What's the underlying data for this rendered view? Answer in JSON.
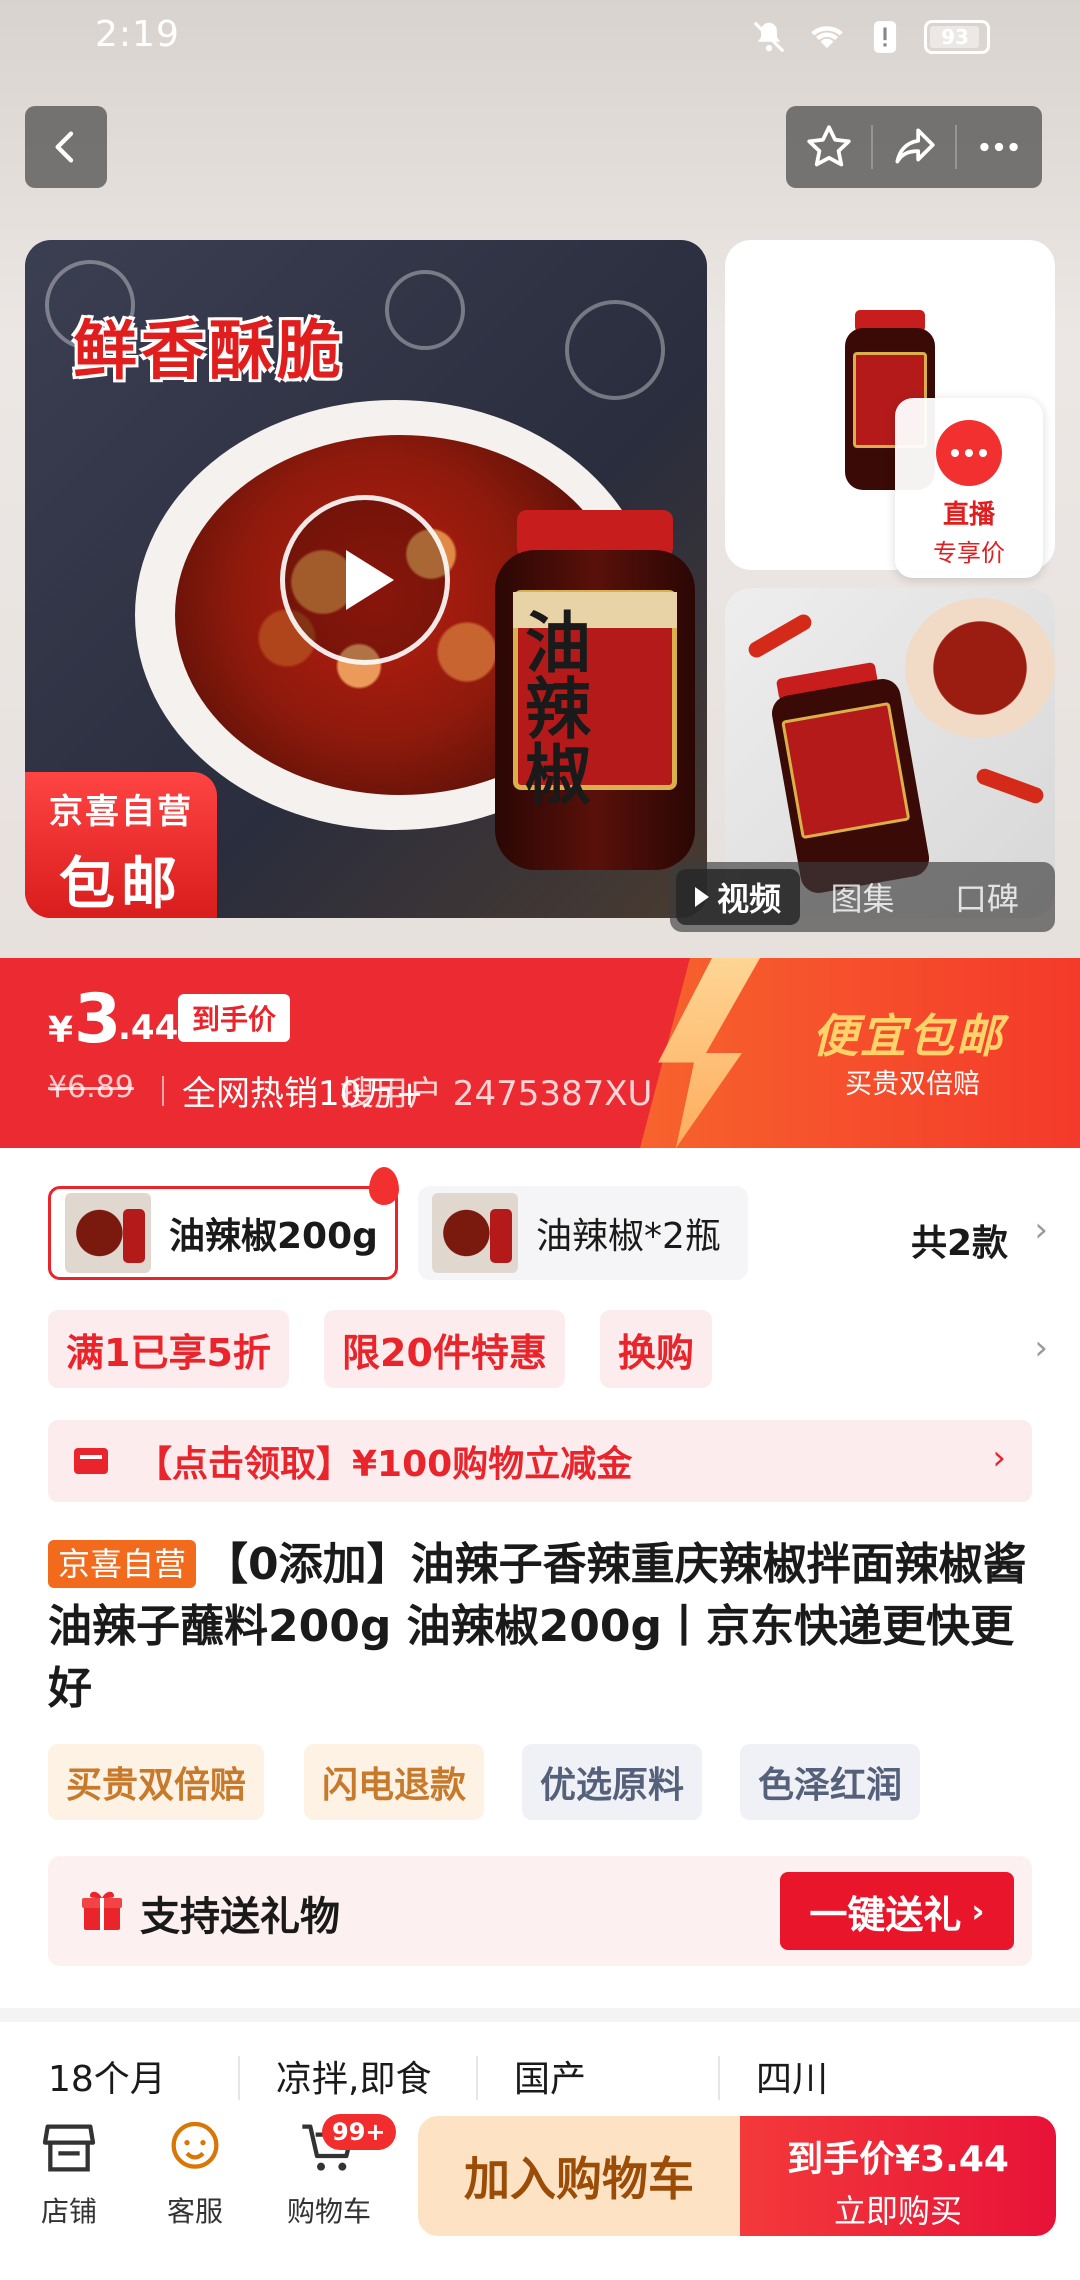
{
  "status": {
    "time": "2:19",
    "battery": "93"
  },
  "gallery": {
    "headline": "鲜香酥脆",
    "badge_line1": "京喜自营",
    "badge_line2": "包邮",
    "jar_label": "油辣椒",
    "live_label": "直播",
    "live_sub": "专享价",
    "tabs": [
      "视频",
      "图集",
      "口碑"
    ]
  },
  "price": {
    "currency": "¥",
    "integer": "3",
    "decimal": ".44",
    "tag": "到手价",
    "original": "¥6.89",
    "sold": "全网热销10万+",
    "watermark": "搜用户 2475387XU",
    "promo_title": "便宜包邮",
    "promo_sub": "买贵双倍赔"
  },
  "skus": {
    "items": [
      {
        "label": "油辣椒200g",
        "selected": true
      },
      {
        "label": "油辣椒*2瓶",
        "selected": false
      }
    ],
    "count": "共2款"
  },
  "promotions": [
    "满1已享5折",
    "限20件特惠",
    "换购"
  ],
  "coupon": "【点击领取】¥100购物立减金",
  "product": {
    "badge": "京喜自营",
    "title": "【0添加】油辣子香辣重庆辣椒拌面辣椒酱油辣子蘸料200g 油辣椒200g丨京东快递更快更好"
  },
  "tags": [
    {
      "label": "买贵双倍赔",
      "style": "warm"
    },
    {
      "label": "闪电退款",
      "style": "warm"
    },
    {
      "label": "优选原料",
      "style": "cool"
    },
    {
      "label": "色泽红润",
      "style": "cool"
    }
  ],
  "gift": {
    "text": "支持送礼物",
    "button": "一键送礼"
  },
  "specs": [
    "18个月",
    "凉拌,即食",
    "国产",
    "四川"
  ],
  "bottom": {
    "store": "店铺",
    "service": "客服",
    "cart": "购物车",
    "cart_badge": "99+",
    "add_cart": "加入购物车",
    "buy_line1": "到手价¥3.44",
    "buy_line2": "立即购买"
  },
  "colors": {
    "brand_red": "#e9242b",
    "orange": "#f26b1d",
    "gold": "#ffd36a"
  }
}
